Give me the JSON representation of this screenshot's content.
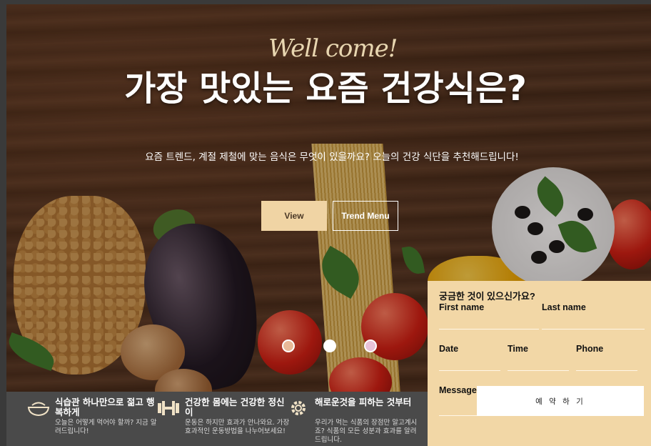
{
  "hero": {
    "welcome": "Well come!",
    "title": "가장 맛있는 요즘 건강식은?",
    "subtitle": "요즘 트렌드, 계절 제철에 맞는 음식은 무엇이 있을까요? 오늘의 건강 식단을 추천해드립니다!",
    "view_label": "View",
    "trend_label": "Trend Menu"
  },
  "slider": {
    "dots": [
      {
        "color": "#e8b998",
        "active": true
      },
      {
        "color": "#ffffff",
        "active": false
      },
      {
        "color": "#e8c3d9",
        "active": false
      }
    ]
  },
  "features": [
    {
      "icon": "bowl-icon",
      "title": "식습관 하나만으로 젊고 행복하게",
      "text": "오늘은 어떻게 먹어야 할까? 지금 알려드립니다!"
    },
    {
      "icon": "dumbbell-icon",
      "title": "건강한 몸에는 건강한 정신이",
      "text": "운동은 하지만 효과가 안나와요. 가장 효과적인 운동방법을 나누어보세요!"
    },
    {
      "icon": "gear-icon",
      "title": "해로운것을 피하는 것부터",
      "text": "우리가 먹는 식품의 장점만 알고계시죠? 식품의 모든 성분과 효과를 알려드립니다."
    }
  ],
  "form": {
    "title": "궁금한 것이 있으신가요?",
    "first_name": "First name",
    "last_name": "Last name",
    "date": "Date",
    "time": "Time",
    "phone": "Phone",
    "message": "Message",
    "submit": "예 약 하 기"
  },
  "colors": {
    "accent": "#f2d7a6",
    "feature_bar": "#4a4a4a"
  }
}
